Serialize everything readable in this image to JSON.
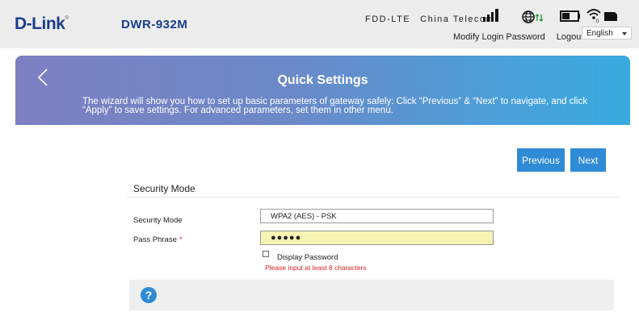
{
  "header": {
    "brand": "D-Link",
    "brand_mark": "®",
    "model": "DWR-932M",
    "network_type": "FDD-LTE",
    "carrier": "China Telecom",
    "sim_count": "0",
    "icons": [
      "signal-icon",
      "globe-data-icon",
      "battery-icon",
      "wifi-icon",
      "sim-card-icon"
    ],
    "links": {
      "modify_password": "Modify Login Password",
      "logout": "Logout"
    },
    "language": {
      "selected": "English"
    }
  },
  "banner": {
    "title": "Quick Settings",
    "description": "The wizard will show you how to set up basic parameters of gateway safely: Click “Previous” & “Next” to navigate, and click “Apply” to save settings. For advanced parameters, set them in other menu."
  },
  "nav": {
    "previous": "Previous",
    "next": "Next"
  },
  "section": {
    "title": "Security Mode",
    "security_mode_label": "Security Mode",
    "security_mode_value": "WPA2 (AES) - PSK",
    "pass_phrase_label": "Pass Phrase",
    "required_mark": "*",
    "pass_phrase_value": "●●●●●",
    "display_password_label": "Display Password",
    "error_message": "Please input at least 8 characters"
  },
  "help": {
    "icon": "?"
  },
  "colors": {
    "brand": "#1a3c8c",
    "accent": "#2f8bd6",
    "error": "#e02020",
    "password_bg": "#f6f3b3"
  }
}
